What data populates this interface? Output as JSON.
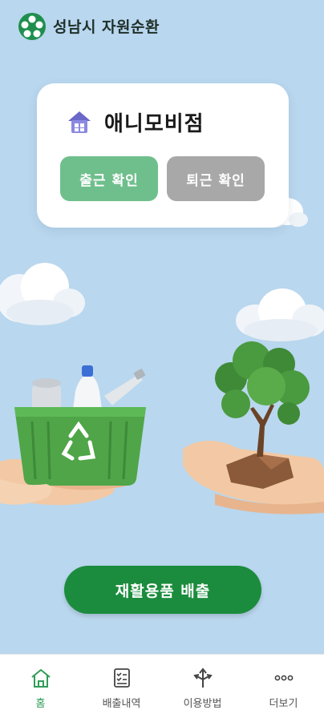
{
  "header": {
    "title": "성남시 자원순환",
    "logo_icon": "seongnam-city-logo"
  },
  "store_card": {
    "store_name": "애니모비점",
    "store_icon": "house-icon",
    "check_in_label": "출근 확인",
    "check_out_label": "퇴근 확인",
    "check_in_color": "#6fbf8c",
    "check_out_color": "#a8a8a8"
  },
  "main": {
    "primary_button_label": "재활용품 배출",
    "primary_color": "#1b8c3d",
    "background_color": "#b9d7ee"
  },
  "bottom_nav": {
    "items": [
      {
        "label": "홈",
        "icon": "home-icon",
        "active": true
      },
      {
        "label": "배출내역",
        "icon": "checklist-icon",
        "active": false
      },
      {
        "label": "이용방법",
        "icon": "directions-icon",
        "active": false
      },
      {
        "label": "더보기",
        "icon": "more-icon",
        "active": false
      }
    ],
    "active_color": "#2f9d57"
  }
}
